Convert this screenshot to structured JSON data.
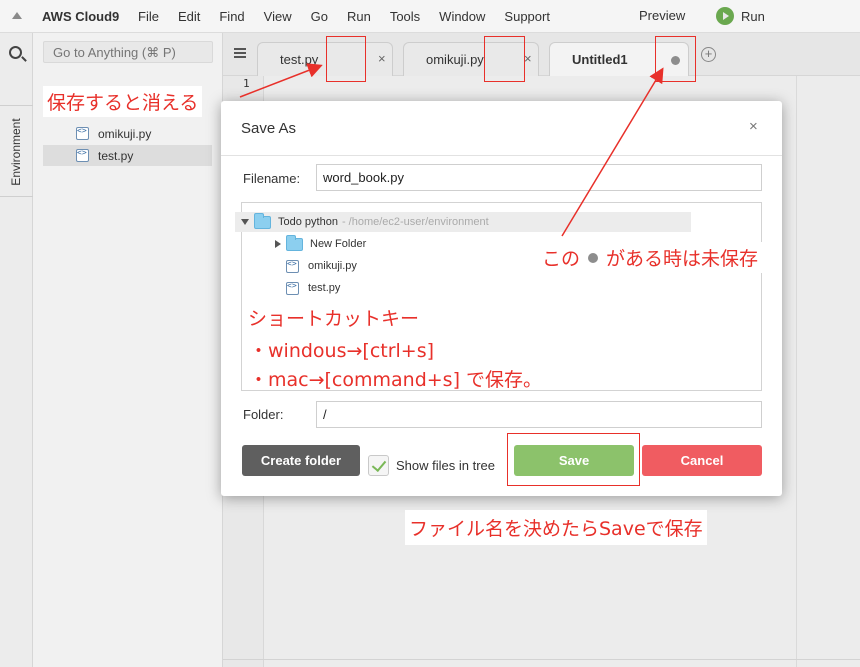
{
  "menubar": {
    "brand": "AWS Cloud9",
    "items": [
      "File",
      "Edit",
      "Find",
      "View",
      "Go",
      "Run",
      "Tools",
      "Window",
      "Support"
    ],
    "preview": "Preview",
    "run": "Run"
  },
  "sidebar": {
    "environment_tab": "Environment",
    "goto_placeholder": "Go to Anything (⌘ P)",
    "files": [
      "omikuji.py",
      "test.py"
    ]
  },
  "tabs": [
    {
      "label": "test.py",
      "close": "×"
    },
    {
      "label": "omikuji.py",
      "close": "×"
    },
    {
      "label": "Untitled1"
    }
  ],
  "editor": {
    "line_number": "1"
  },
  "dialog": {
    "title": "Save As",
    "close": "×",
    "filename_label": "Filename:",
    "filename_value": "word_book.py",
    "tree": {
      "root_name": "Todo python",
      "root_path": "- /home/ec2-user/environment",
      "items": [
        "New Folder",
        "omikuji.py",
        "test.py"
      ]
    },
    "folder_label": "Folder:",
    "folder_value": "/",
    "create_folder": "Create folder",
    "show_files": "Show files in tree",
    "save": "Save",
    "cancel": "Cancel"
  },
  "annotations": {
    "saved_disappears": "保存すると消える",
    "unsaved_dot_prefix": "この",
    "unsaved_dot_suffix": "がある時は未保存",
    "shortcut_title": "ショートカットキー",
    "shortcut_windows": "・windous→[ctrl+s]",
    "shortcut_mac": "・mac→[command+s]  で保存。",
    "save_hint": "ファイル名を決めたらSaveで保存",
    "color": "#e8302a"
  }
}
